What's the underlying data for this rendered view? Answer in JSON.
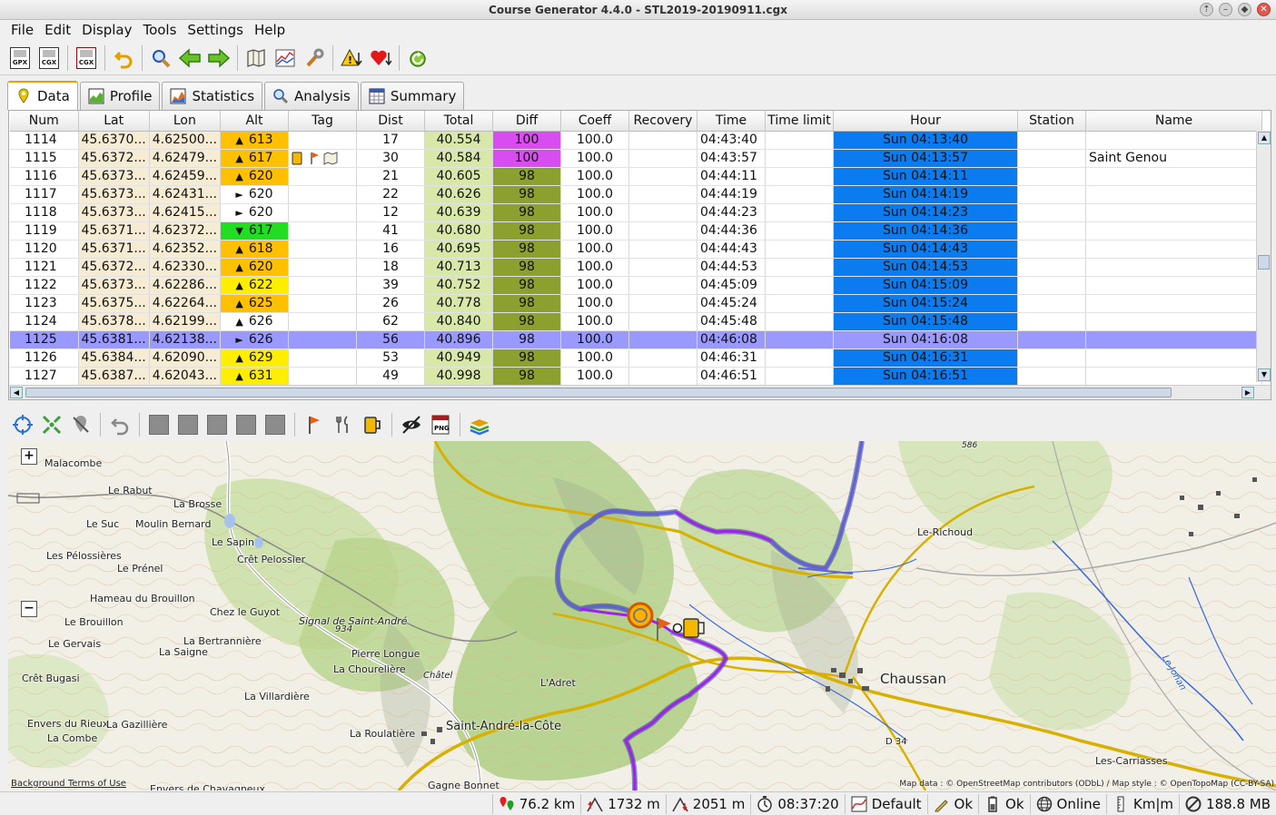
{
  "window": {
    "title": "Course Generator 4.4.0 - STL2019-20190911.cgx"
  },
  "menu": [
    "File",
    "Edit",
    "Display",
    "Tools",
    "Settings",
    "Help"
  ],
  "toolbar": {
    "open_gpx": "GPX",
    "open_cgx": "CGX",
    "save_cgx": "CGX",
    "icons": [
      "undo-icon",
      "search-icon",
      "arrow-left-icon",
      "arrow-right-icon",
      "mini-map-icon",
      "mini-chart-icon",
      "settings-wrench-icon",
      "warning-icon",
      "heart-icon",
      "refresh-icon"
    ]
  },
  "tabs": [
    {
      "label": "Data",
      "active": true
    },
    {
      "label": "Profile"
    },
    {
      "label": "Statistics"
    },
    {
      "label": "Analysis"
    },
    {
      "label": "Summary"
    }
  ],
  "table": {
    "columns": [
      "Num",
      "Lat",
      "Lon",
      "Alt",
      "Tag",
      "Dist",
      "Total",
      "Diff",
      "Coeff",
      "Recovery",
      "Time",
      "Time limit",
      "Hour",
      "Station",
      "Name"
    ],
    "selected_row": "1125",
    "rows": [
      {
        "num": "1114",
        "lat": "45.6370...",
        "lon": "4.62500...",
        "arrow": "▲",
        "alt": "613",
        "alt_color": "#ffc000",
        "tag": "",
        "dist": "17",
        "total": "40.554",
        "diff": "100",
        "diff_color": "#d84cf0",
        "coeff": "100.0",
        "recovery": "",
        "time": "04:43:40",
        "timelimit": "",
        "hour": "Sun 04:13:40",
        "station": "",
        "name": ""
      },
      {
        "num": "1115",
        "lat": "45.6372...",
        "lon": "4.62479...",
        "arrow": "▲",
        "alt": "617",
        "alt_color": "#ffc000",
        "tag": "icons",
        "dist": "30",
        "total": "40.584",
        "diff": "100",
        "diff_color": "#d84cf0",
        "coeff": "100.0",
        "recovery": "",
        "time": "04:43:57",
        "timelimit": "",
        "hour": "Sun 04:13:57",
        "station": "",
        "name": "Saint Genou"
      },
      {
        "num": "1116",
        "lat": "45.6373...",
        "lon": "4.62459...",
        "arrow": "▲",
        "alt": "620",
        "alt_color": "#ffc000",
        "tag": "",
        "dist": "21",
        "total": "40.605",
        "diff": "98",
        "diff_color": "#8ca030",
        "coeff": "100.0",
        "recovery": "",
        "time": "04:44:11",
        "timelimit": "",
        "hour": "Sun 04:14:11",
        "station": "",
        "name": ""
      },
      {
        "num": "1117",
        "lat": "45.6373...",
        "lon": "4.62431...",
        "arrow": "►",
        "alt": "620",
        "alt_color": "#ffffff",
        "tag": "",
        "dist": "22",
        "total": "40.626",
        "diff": "98",
        "diff_color": "#8ca030",
        "coeff": "100.0",
        "recovery": "",
        "time": "04:44:19",
        "timelimit": "",
        "hour": "Sun 04:14:19",
        "station": "",
        "name": ""
      },
      {
        "num": "1118",
        "lat": "45.6373...",
        "lon": "4.62415...",
        "arrow": "►",
        "alt": "620",
        "alt_color": "#ffffff",
        "tag": "",
        "dist": "12",
        "total": "40.639",
        "diff": "98",
        "diff_color": "#8ca030",
        "coeff": "100.0",
        "recovery": "",
        "time": "04:44:23",
        "timelimit": "",
        "hour": "Sun 04:14:23",
        "station": "",
        "name": ""
      },
      {
        "num": "1119",
        "lat": "45.6371...",
        "lon": "4.62372...",
        "arrow": "▼",
        "alt": "617",
        "alt_color": "#22dd22",
        "tag": "",
        "dist": "41",
        "total": "40.680",
        "diff": "98",
        "diff_color": "#8ca030",
        "coeff": "100.0",
        "recovery": "",
        "time": "04:44:36",
        "timelimit": "",
        "hour": "Sun 04:14:36",
        "station": "",
        "name": ""
      },
      {
        "num": "1120",
        "lat": "45.6371...",
        "lon": "4.62352...",
        "arrow": "▲",
        "alt": "618",
        "alt_color": "#ffc000",
        "tag": "",
        "dist": "16",
        "total": "40.695",
        "diff": "98",
        "diff_color": "#8ca030",
        "coeff": "100.0",
        "recovery": "",
        "time": "04:44:43",
        "timelimit": "",
        "hour": "Sun 04:14:43",
        "station": "",
        "name": ""
      },
      {
        "num": "1121",
        "lat": "45.6372...",
        "lon": "4.62330...",
        "arrow": "▲",
        "alt": "620",
        "alt_color": "#ffc000",
        "tag": "",
        "dist": "18",
        "total": "40.713",
        "diff": "98",
        "diff_color": "#8ca030",
        "coeff": "100.0",
        "recovery": "",
        "time": "04:44:53",
        "timelimit": "",
        "hour": "Sun 04:14:53",
        "station": "",
        "name": ""
      },
      {
        "num": "1122",
        "lat": "45.6373...",
        "lon": "4.62286...",
        "arrow": "▲",
        "alt": "622",
        "alt_color": "#ffee00",
        "tag": "",
        "dist": "39",
        "total": "40.752",
        "diff": "98",
        "diff_color": "#8ca030",
        "coeff": "100.0",
        "recovery": "",
        "time": "04:45:09",
        "timelimit": "",
        "hour": "Sun 04:15:09",
        "station": "",
        "name": ""
      },
      {
        "num": "1123",
        "lat": "45.6375...",
        "lon": "4.62264...",
        "arrow": "▲",
        "alt": "625",
        "alt_color": "#ffc000",
        "tag": "",
        "dist": "26",
        "total": "40.778",
        "diff": "98",
        "diff_color": "#8ca030",
        "coeff": "100.0",
        "recovery": "",
        "time": "04:45:24",
        "timelimit": "",
        "hour": "Sun 04:15:24",
        "station": "",
        "name": ""
      },
      {
        "num": "1124",
        "lat": "45.6378...",
        "lon": "4.62199...",
        "arrow": "▲",
        "alt": "626",
        "alt_color": "#ffffff",
        "tag": "",
        "dist": "62",
        "total": "40.840",
        "diff": "98",
        "diff_color": "#8ca030",
        "coeff": "100.0",
        "recovery": "",
        "time": "04:45:48",
        "timelimit": "",
        "hour": "Sun 04:15:48",
        "station": "",
        "name": ""
      },
      {
        "num": "1125",
        "lat": "45.6381...",
        "lon": "4.62138...",
        "arrow": "►",
        "alt": "626",
        "alt_color": "#ffffff",
        "tag": "",
        "dist": "56",
        "total": "40.896",
        "diff": "98",
        "diff_color": "#8ca030",
        "coeff": "100.0",
        "recovery": "",
        "time": "04:46:08",
        "timelimit": "",
        "hour": "Sun 04:16:08",
        "station": "",
        "name": ""
      },
      {
        "num": "1126",
        "lat": "45.6384...",
        "lon": "4.62090...",
        "arrow": "▲",
        "alt": "629",
        "alt_color": "#ffee00",
        "tag": "",
        "dist": "53",
        "total": "40.949",
        "diff": "98",
        "diff_color": "#8ca030",
        "coeff": "100.0",
        "recovery": "",
        "time": "04:46:31",
        "timelimit": "",
        "hour": "Sun 04:16:31",
        "station": "",
        "name": ""
      },
      {
        "num": "1127",
        "lat": "45.6387...",
        "lon": "4.62043...",
        "arrow": "▲",
        "alt": "631",
        "alt_color": "#ffee00",
        "tag": "",
        "dist": "49",
        "total": "40.998",
        "diff": "98",
        "diff_color": "#8ca030",
        "coeff": "100.0",
        "recovery": "",
        "time": "04:46:51",
        "timelimit": "",
        "hour": "Sun 04:16:51",
        "station": "",
        "name": ""
      }
    ]
  },
  "map": {
    "labels": [
      "Malacombe",
      "Le Rabut",
      "La Brosse",
      "Le Suc",
      "Moulin Bernard",
      "Le Sapin",
      "Crêt Pelossier",
      "Les Pélossières",
      "Le Prénel",
      "Hameau du Brouillon",
      "Chez le Guyot",
      "Signal de Saint-André",
      "934",
      "Le Brouillon",
      "La Bertrannière",
      "Le Gervais",
      "La Saigne",
      "Pierre Longue",
      "La Chourelière",
      "Crêt Bugasi",
      "Châtel",
      "L'Adret",
      "La Villardière",
      "Envers du Rieux",
      "La Gazillière",
      "La Roulatière",
      "Saint-André-la-Côte",
      "La Combe",
      "Gagne Bonnet",
      "Envers de Chavagneux",
      "Chaussan",
      "Le-Richoud",
      "Les-Carriasses",
      "586",
      "D 34",
      "Le Jonan"
    ],
    "attribution_left": "Background Terms of Use",
    "attribution_right": "Map data : © OpenStreetMap contributors (ODbL) / Map style : © OpenTopoMap (CC-BY-SA)",
    "zoom_in": "+",
    "zoom_out": "−"
  },
  "status": {
    "distance": "76.2 km",
    "climb": "1732 m",
    "descent": "2051 m",
    "time": "08:37:20",
    "curve": "Default",
    "edit_state": "Ok",
    "battery_state": "Ok",
    "connection": "Online",
    "units": "Km|m",
    "memory": "188.8 MB"
  },
  "colors": {
    "hour_bg": "#0a7cf0",
    "selected_row": "#9999ff",
    "track_blue": "#5050c8",
    "track_purple": "#a020f0"
  }
}
